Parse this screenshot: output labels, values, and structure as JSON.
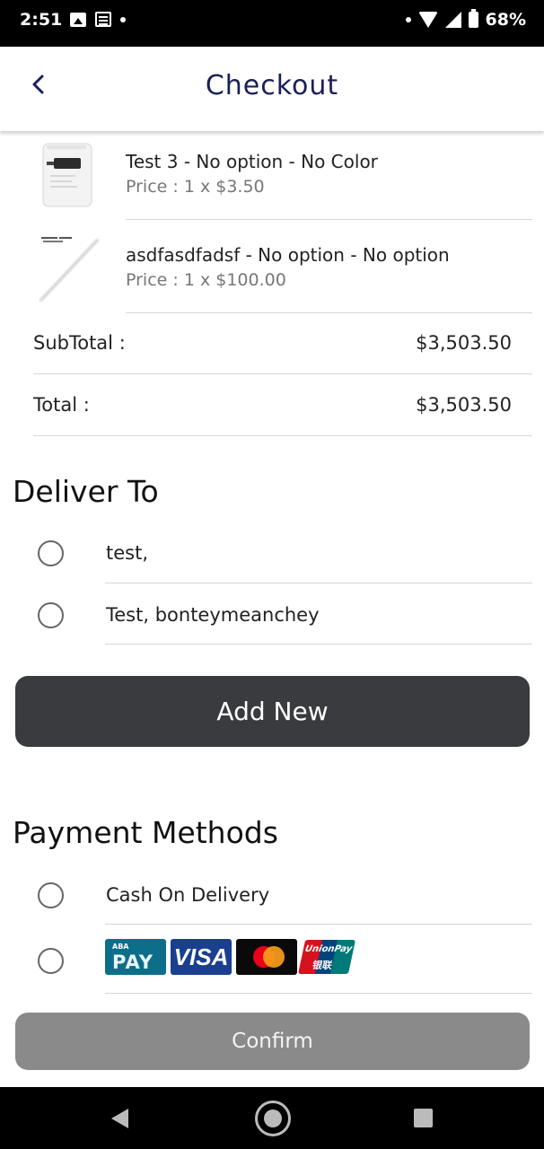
{
  "status_bar": {
    "time": "2:51",
    "battery": "68%",
    "icons": [
      "image-icon",
      "news-icon",
      "dot-icon",
      "wifi-icon",
      "signal-icon",
      "battery-icon"
    ]
  },
  "header": {
    "title": "Checkout",
    "back_icon": "chevron-left-icon",
    "title_color": "#1a1f5a"
  },
  "cart": {
    "items": [
      {
        "title": "Test 3 - No option - No Color",
        "price": "Price : 1 x $3.50"
      },
      {
        "title": "asdfasdfadsf - No option - No option",
        "price": "Price : 1 x $100.00"
      }
    ]
  },
  "summary": {
    "subtotal_label": "SubTotal :",
    "subtotal_value": "$3,503.50",
    "total_label": "Total :",
    "total_value": "$3,503.50"
  },
  "delivery": {
    "title": "Deliver To",
    "addresses": [
      {
        "label": "test,"
      },
      {
        "label": "Test, bonteymeanchey"
      }
    ],
    "add_new_label": "Add New"
  },
  "payment": {
    "title": "Payment Methods",
    "methods": [
      {
        "label": "Cash On Delivery"
      }
    ],
    "card_logos": {
      "aba_small": "ABA",
      "aba_main": "PAY",
      "visa": "VISA",
      "unionpay": "UnionPay",
      "unionpay_cn": "银联"
    }
  },
  "actions": {
    "confirm_label": "Confirm"
  },
  "colors": {
    "add_new_bg": "#3a3b3f",
    "confirm_bg": "#8a8a8a",
    "aba_blue": "#0d6e8a",
    "visa_blue": "#1a3f8f"
  }
}
